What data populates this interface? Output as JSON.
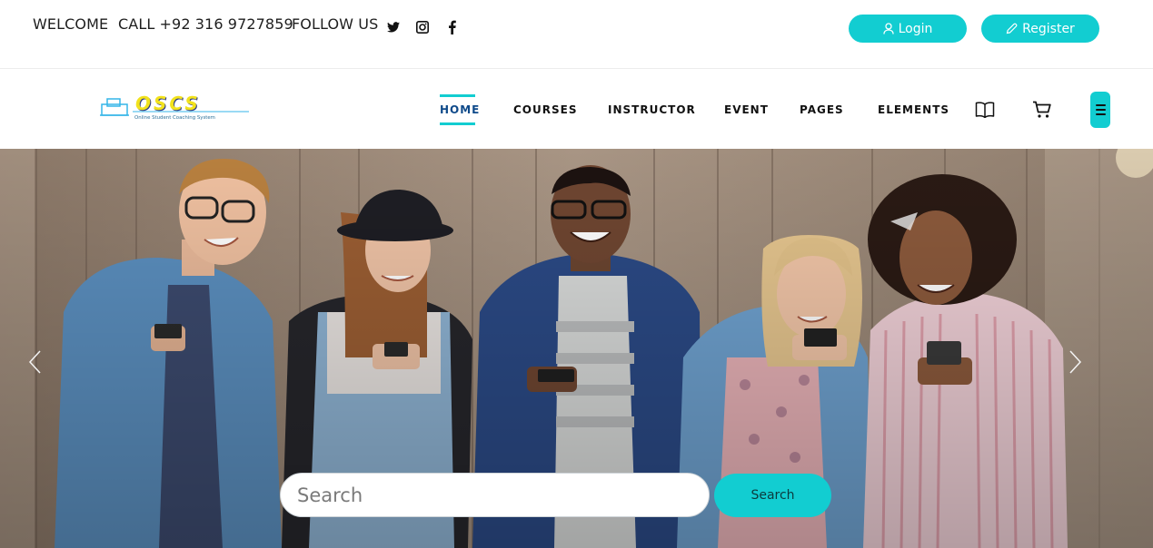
{
  "topbar": {
    "welcome": "WELCOME",
    "call": "CALL +92 316 9727859",
    "follow": "FOLLOW US",
    "social": [
      "twitter-icon",
      "instagram-icon",
      "facebook-icon"
    ],
    "login_label": "Login",
    "register_label": "Register"
  },
  "brand": {
    "name": "OSCS",
    "tagline": "Online Student Coaching System"
  },
  "nav": {
    "items": [
      "HOME",
      "COURSES",
      "INSTRUCTOR",
      "EVENT",
      "PAGES",
      "ELEMENTS"
    ],
    "active": "HOME",
    "icons": [
      "book-icon",
      "cart-icon",
      "hamburger-icon"
    ]
  },
  "hero": {
    "search_placeholder": "Search",
    "search_button": "Search"
  },
  "colors": {
    "accent": "#12cdd1",
    "active_nav": "#0f4a8a"
  }
}
